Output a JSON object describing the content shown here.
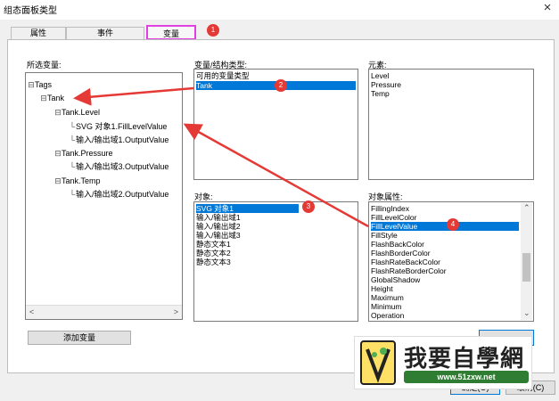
{
  "window": {
    "title": "组态面板类型",
    "close_glyph": "×"
  },
  "tabs": [
    {
      "label": "属性",
      "active": false
    },
    {
      "label": "事件",
      "active": false
    },
    {
      "label": "变量",
      "active": true
    }
  ],
  "left": {
    "label": "所选变量:",
    "tree": [
      {
        "text": "Tags",
        "level": 0,
        "icon": "expanded-node-icon"
      },
      {
        "text": "Tank",
        "level": 1,
        "icon": "expanded-node-icon"
      },
      {
        "text": "Tank.Level",
        "level": 2,
        "icon": "expanded-node-icon"
      },
      {
        "text": "SVG 对象1.FillLevelValue",
        "level": 3,
        "icon": "leaf-line-icon"
      },
      {
        "text": "输入/输出域1.OutputValue",
        "level": 3,
        "icon": "leaf-line-icon"
      },
      {
        "text": "Tank.Pressure",
        "level": 2,
        "icon": "expanded-node-icon"
      },
      {
        "text": "输入/输出域3.OutputValue",
        "level": 3,
        "icon": "leaf-line-icon"
      },
      {
        "text": "Tank.Temp",
        "level": 2,
        "icon": "expanded-node-icon"
      },
      {
        "text": "输入/输出域2.OutputValue",
        "level": 3,
        "icon": "leaf-line-icon"
      }
    ],
    "scroll_left": "<",
    "scroll_right": ">",
    "add_button": "添加变量"
  },
  "var_types": {
    "label": "变量/结构类型:",
    "items": [
      {
        "text": "可用的变量类型",
        "selected": false
      },
      {
        "text": "Tank",
        "selected": true
      }
    ]
  },
  "elements": {
    "label": "元素:",
    "items": [
      "Level",
      "Pressure",
      "Temp"
    ]
  },
  "objects": {
    "label": "对象:",
    "items": [
      {
        "text": "SVG 对象1",
        "selected": true
      },
      {
        "text": "输入/输出域1",
        "selected": false
      },
      {
        "text": "输入/输出域2",
        "selected": false
      },
      {
        "text": "输入/输出域3",
        "selected": false
      },
      {
        "text": "静态文本1",
        "selected": false
      },
      {
        "text": "静态文本2",
        "selected": false
      },
      {
        "text": "静态文本3",
        "selected": false
      }
    ]
  },
  "object_props": {
    "label": "对象属性:",
    "items": [
      {
        "text": "FillingIndex",
        "selected": false
      },
      {
        "text": "FillLevelColor",
        "selected": false
      },
      {
        "text": "FillLevelValue",
        "selected": true
      },
      {
        "text": "FillStyle",
        "selected": false
      },
      {
        "text": "FlashBackColor",
        "selected": false
      },
      {
        "text": "FlashBorderColor",
        "selected": false
      },
      {
        "text": "FlashRateBackColor",
        "selected": false
      },
      {
        "text": "FlashRateBorderColor",
        "selected": false
      },
      {
        "text": "GlobalShadow",
        "selected": false
      },
      {
        "text": "Height",
        "selected": false
      },
      {
        "text": "Maximum",
        "selected": false
      },
      {
        "text": "Minimum",
        "selected": false
      },
      {
        "text": "Operation",
        "selected": false
      }
    ],
    "scroll_up": "⌃",
    "scroll_down": "⌄"
  },
  "badges": [
    "1",
    "2",
    "3",
    "4"
  ],
  "buttons": {
    "ok": "确定(O)",
    "cancel": "取消(C)"
  },
  "watermark": {
    "title": "我要自學網",
    "url": "www.51zxw.net"
  },
  "colors": {
    "selection": "#0078d7",
    "arrow": "#e53935",
    "active_tab_border": "#e040e0"
  }
}
